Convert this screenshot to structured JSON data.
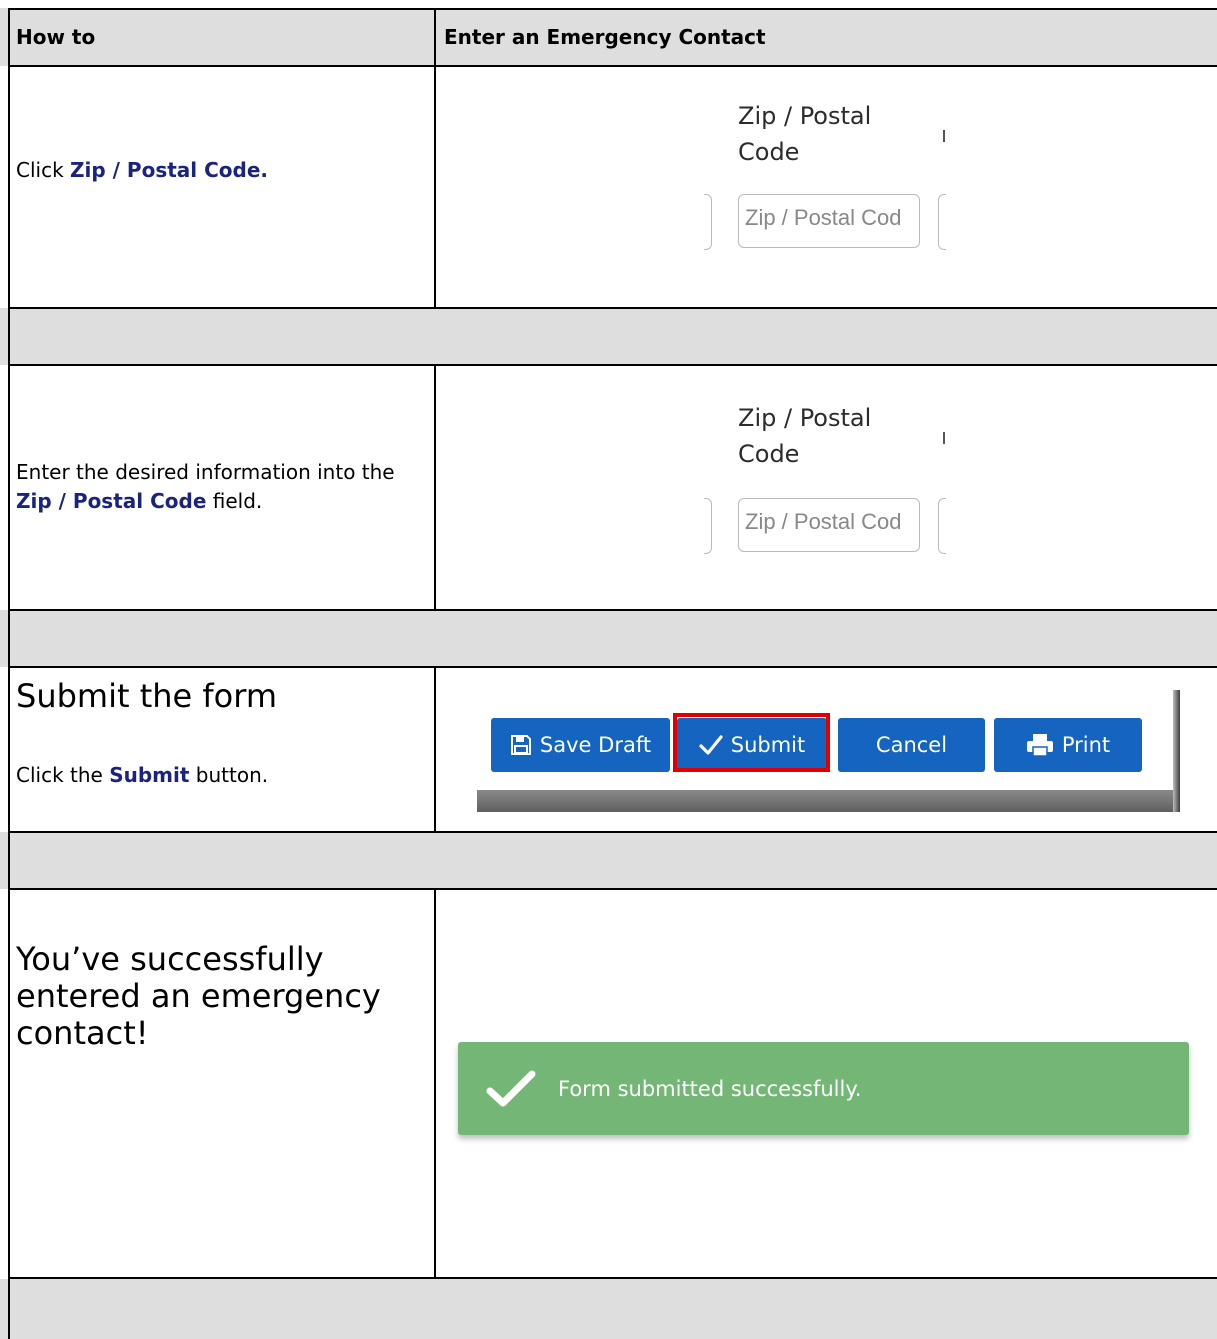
{
  "header": {
    "col1": "How to",
    "col2": "Enter an Emergency Contact"
  },
  "step1": {
    "prefix": "Click ",
    "keyword": "Zip / Postal Code.",
    "zip_label_line1": "Zip / Postal",
    "zip_label_line2": "Code",
    "zip_placeholder": "Zip / Postal Cod"
  },
  "step2": {
    "prefix": "Enter the desired information into the ",
    "keyword": "Zip / Postal Code",
    "suffix": " field.",
    "zip_label_line1": "Zip / Postal",
    "zip_label_line2": "Code",
    "zip_placeholder": "Zip / Postal Cod"
  },
  "step3": {
    "heading": "Submit the form",
    "prefix": "Click the ",
    "keyword": "Submit",
    "suffix": " button.",
    "buttons": {
      "save_draft": "Save Draft",
      "submit": "Submit",
      "cancel": "Cancel",
      "print": "Print"
    }
  },
  "step4": {
    "message": " You’ve successfully entered an emergency contact!",
    "banner_text": "Form submitted successfully."
  },
  "colors": {
    "keyword": "#1a237e",
    "button": "#1565c0",
    "highlight": "#e00000",
    "success": "#74b675",
    "separator": "#dedede"
  }
}
